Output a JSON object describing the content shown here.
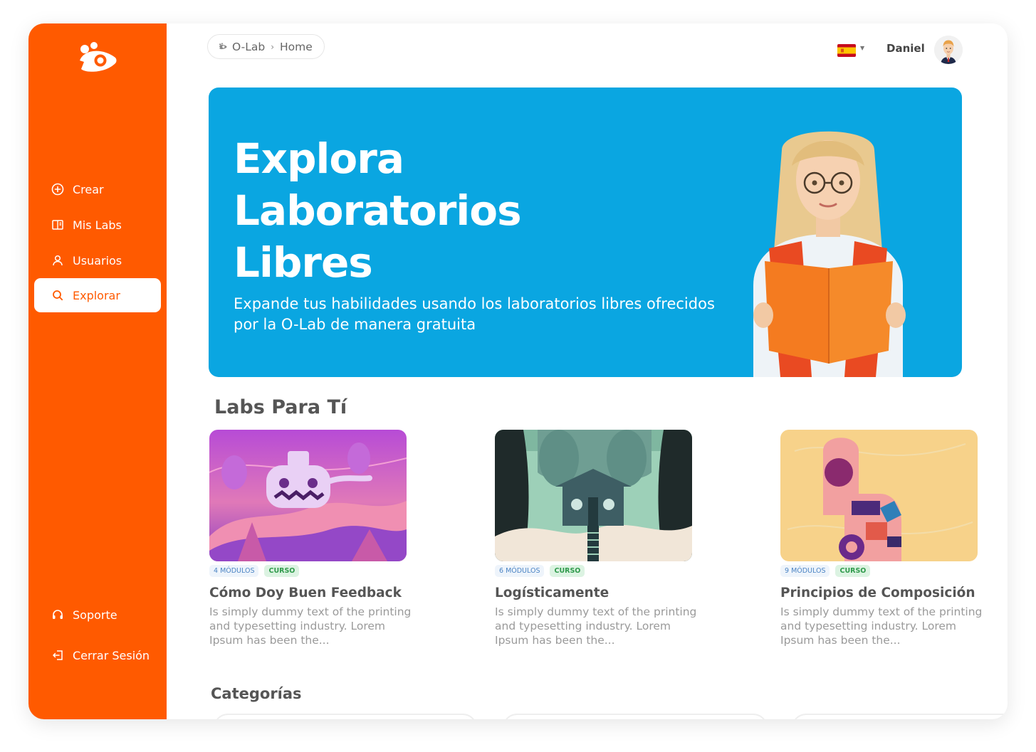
{
  "sidebar": {
    "items": [
      {
        "label": "Crear",
        "icon": "plus-circle-icon"
      },
      {
        "label": "Mis Labs",
        "icon": "book-icon"
      },
      {
        "label": "Usuarios",
        "icon": "user-icon"
      },
      {
        "label": "Explorar",
        "icon": "search-icon",
        "active": true
      }
    ],
    "bottom_items": [
      {
        "label": "Soporte",
        "icon": "headset-icon"
      },
      {
        "label": "Cerrar Sesión",
        "icon": "logout-icon"
      }
    ]
  },
  "header": {
    "breadcrumb": {
      "root": "O-Lab",
      "separator": "›",
      "current": "Home"
    },
    "language": "es",
    "user_name": "Daniel"
  },
  "hero": {
    "title_lines": [
      "Explora",
      "Laboratorios",
      "Libres"
    ],
    "subtitle": "Expande tus habilidades usando los laboratorios libres ofrecidos por la O-Lab de manera gratuita"
  },
  "labs_section": {
    "title": "Labs Para Tí",
    "cards": [
      {
        "modules": "4 MÓDULOS",
        "kind": "CURSO",
        "title": "Cómo Doy Buen Feedback",
        "description": "Is simply dummy text of the printing and typesetting industry. Lorem Ipsum has been the..."
      },
      {
        "modules": "6 MÓDULOS",
        "kind": "CURSO",
        "title": "Logísticamente",
        "description": "Is simply dummy text of the printing and typesetting industry. Lorem Ipsum has been the..."
      },
      {
        "modules": "9 MÓDULOS",
        "kind": "CURSO",
        "title": "Principios de Composición",
        "description": "Is simply dummy text of the printing and typesetting industry. Lorem Ipsum has been the..."
      }
    ]
  },
  "categories_section": {
    "title": "Categorías"
  },
  "colors": {
    "brand_orange": "#FF5A00",
    "hero_blue": "#0AA6E1",
    "badge_green": "#2f9a4b",
    "badge_blue": "#4b84c4"
  }
}
